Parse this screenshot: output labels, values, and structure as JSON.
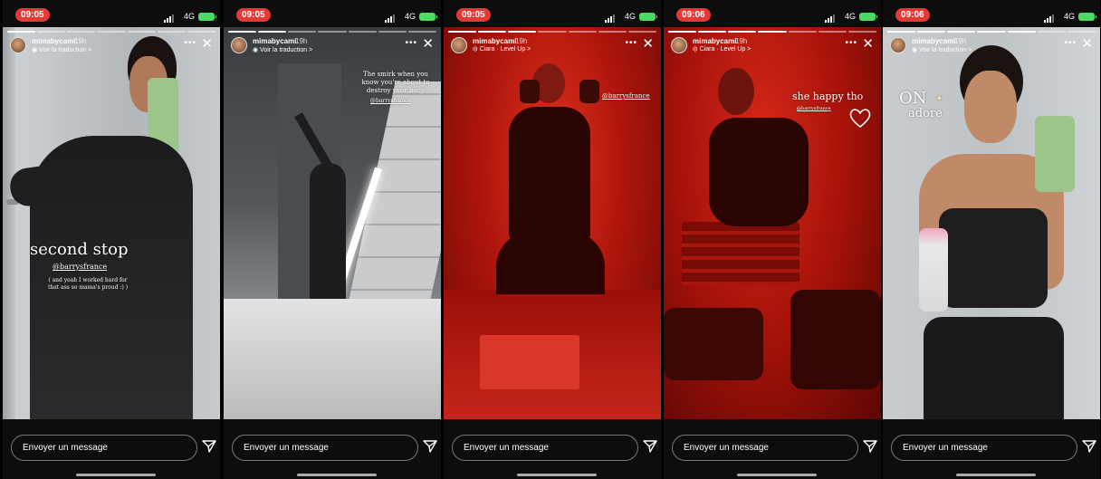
{
  "stories": [
    {
      "time": "09:05",
      "network": "4G",
      "username": "mimabycami",
      "age": "19h",
      "subtitle": "◉ Voir la traduction >",
      "overlay": {
        "title": "second stop",
        "mention": "@barrysfrance",
        "caption": "( and yeah I worked hard for that ass so mama's proud :) )"
      },
      "message_placeholder": "Envoyer un message"
    },
    {
      "time": "09:05",
      "network": "4G",
      "username": "mimabycami",
      "age": "19h",
      "subtitle": "◉ Voir la traduction >",
      "overlay": {
        "caption": "The smirk when you know you're about to destroy your body",
        "mention": "@barrysfrance"
      },
      "message_placeholder": "Envoyer un message"
    },
    {
      "time": "09:05",
      "network": "4G",
      "username": "mimabycami",
      "age": "19h",
      "subtitle": "ı|ı Ciara · Level Up >",
      "overlay": {
        "mention": "@barrysfrance"
      },
      "message_placeholder": "Envoyer un message"
    },
    {
      "time": "09:06",
      "network": "4G",
      "username": "mimabycami",
      "age": "19h",
      "subtitle": "ı|ı Ciara · Level Up >",
      "overlay": {
        "title": "she happy tho",
        "mention": "@barrysfrance"
      },
      "message_placeholder": "Envoyer un message"
    },
    {
      "time": "09:06",
      "network": "4G",
      "username": "mimabycami",
      "age": "19h",
      "subtitle": "◉ Voir la traduction >",
      "overlay": {
        "line1": "ON",
        "line2": "adore"
      },
      "message_placeholder": "Envoyer un message"
    }
  ],
  "icons": {
    "more": "more-icon",
    "close": "close-icon",
    "send": "send-icon",
    "battery": "battery-icon",
    "signal": "signal-icon"
  },
  "colors": {
    "time_pill": "#e53935",
    "battery": "#4cd964",
    "red_light": "#d81e10"
  }
}
